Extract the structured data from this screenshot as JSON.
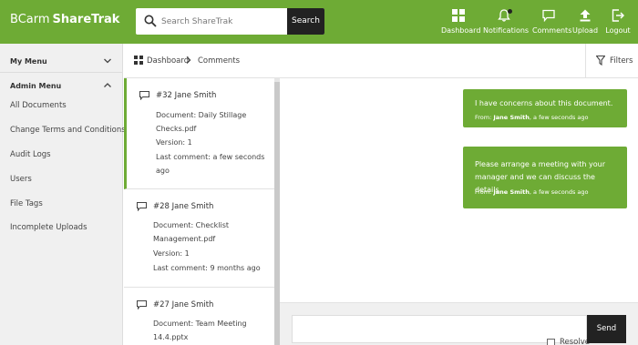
{
  "app": {
    "brand": "BCarm",
    "product": "ShareTrak"
  },
  "search": {
    "placeholder": "Search ShareTrak",
    "button_label": "Search"
  },
  "nav": {
    "dashboard": "Dashboard",
    "notifications": "Notifications",
    "comments": "Comments",
    "upload": "Upload",
    "logout": "Logout"
  },
  "sidebar": {
    "my_menu": "My Menu",
    "admin_menu": "Admin Menu",
    "items": [
      "All Documents",
      "Change Terms and Conditions",
      "Audit Logs",
      "Users",
      "File Tags",
      "Incomplete Uploads"
    ]
  },
  "breadcrumb": {
    "home": "Dashboard",
    "current": "Comments"
  },
  "filters_label": "Filters",
  "comments": [
    {
      "title": "#32 Jane Smith",
      "document": "Document: Daily Stillage Checks.pdf",
      "version": "Version: 1",
      "last": "Last comment: a few seconds ago"
    },
    {
      "title": "#28 Jane Smith",
      "document": "Document: Checklist Management.pdf",
      "version": "Version: 1",
      "last": "Last comment: 9 months ago"
    },
    {
      "title": "#27 Jane Smith",
      "document": "Document: Team Meeting 14.4.pptx",
      "version": "",
      "last": ""
    }
  ],
  "messages": [
    {
      "text": "I have concerns about this document.",
      "from_prefix": "From: ",
      "author": "Jane Smith",
      "time": ", a few seconds ago"
    },
    {
      "text": "Please arrange a meeting with your manager and we can discuss the details.",
      "from_prefix": "From: ",
      "author": "Jane Smith",
      "time": ", a few seconds ago"
    }
  ],
  "reply": {
    "resolve_label": "Resolve",
    "send_label": "Send"
  },
  "colors": {
    "accent": "#6eab35",
    "dark": "#222222"
  }
}
